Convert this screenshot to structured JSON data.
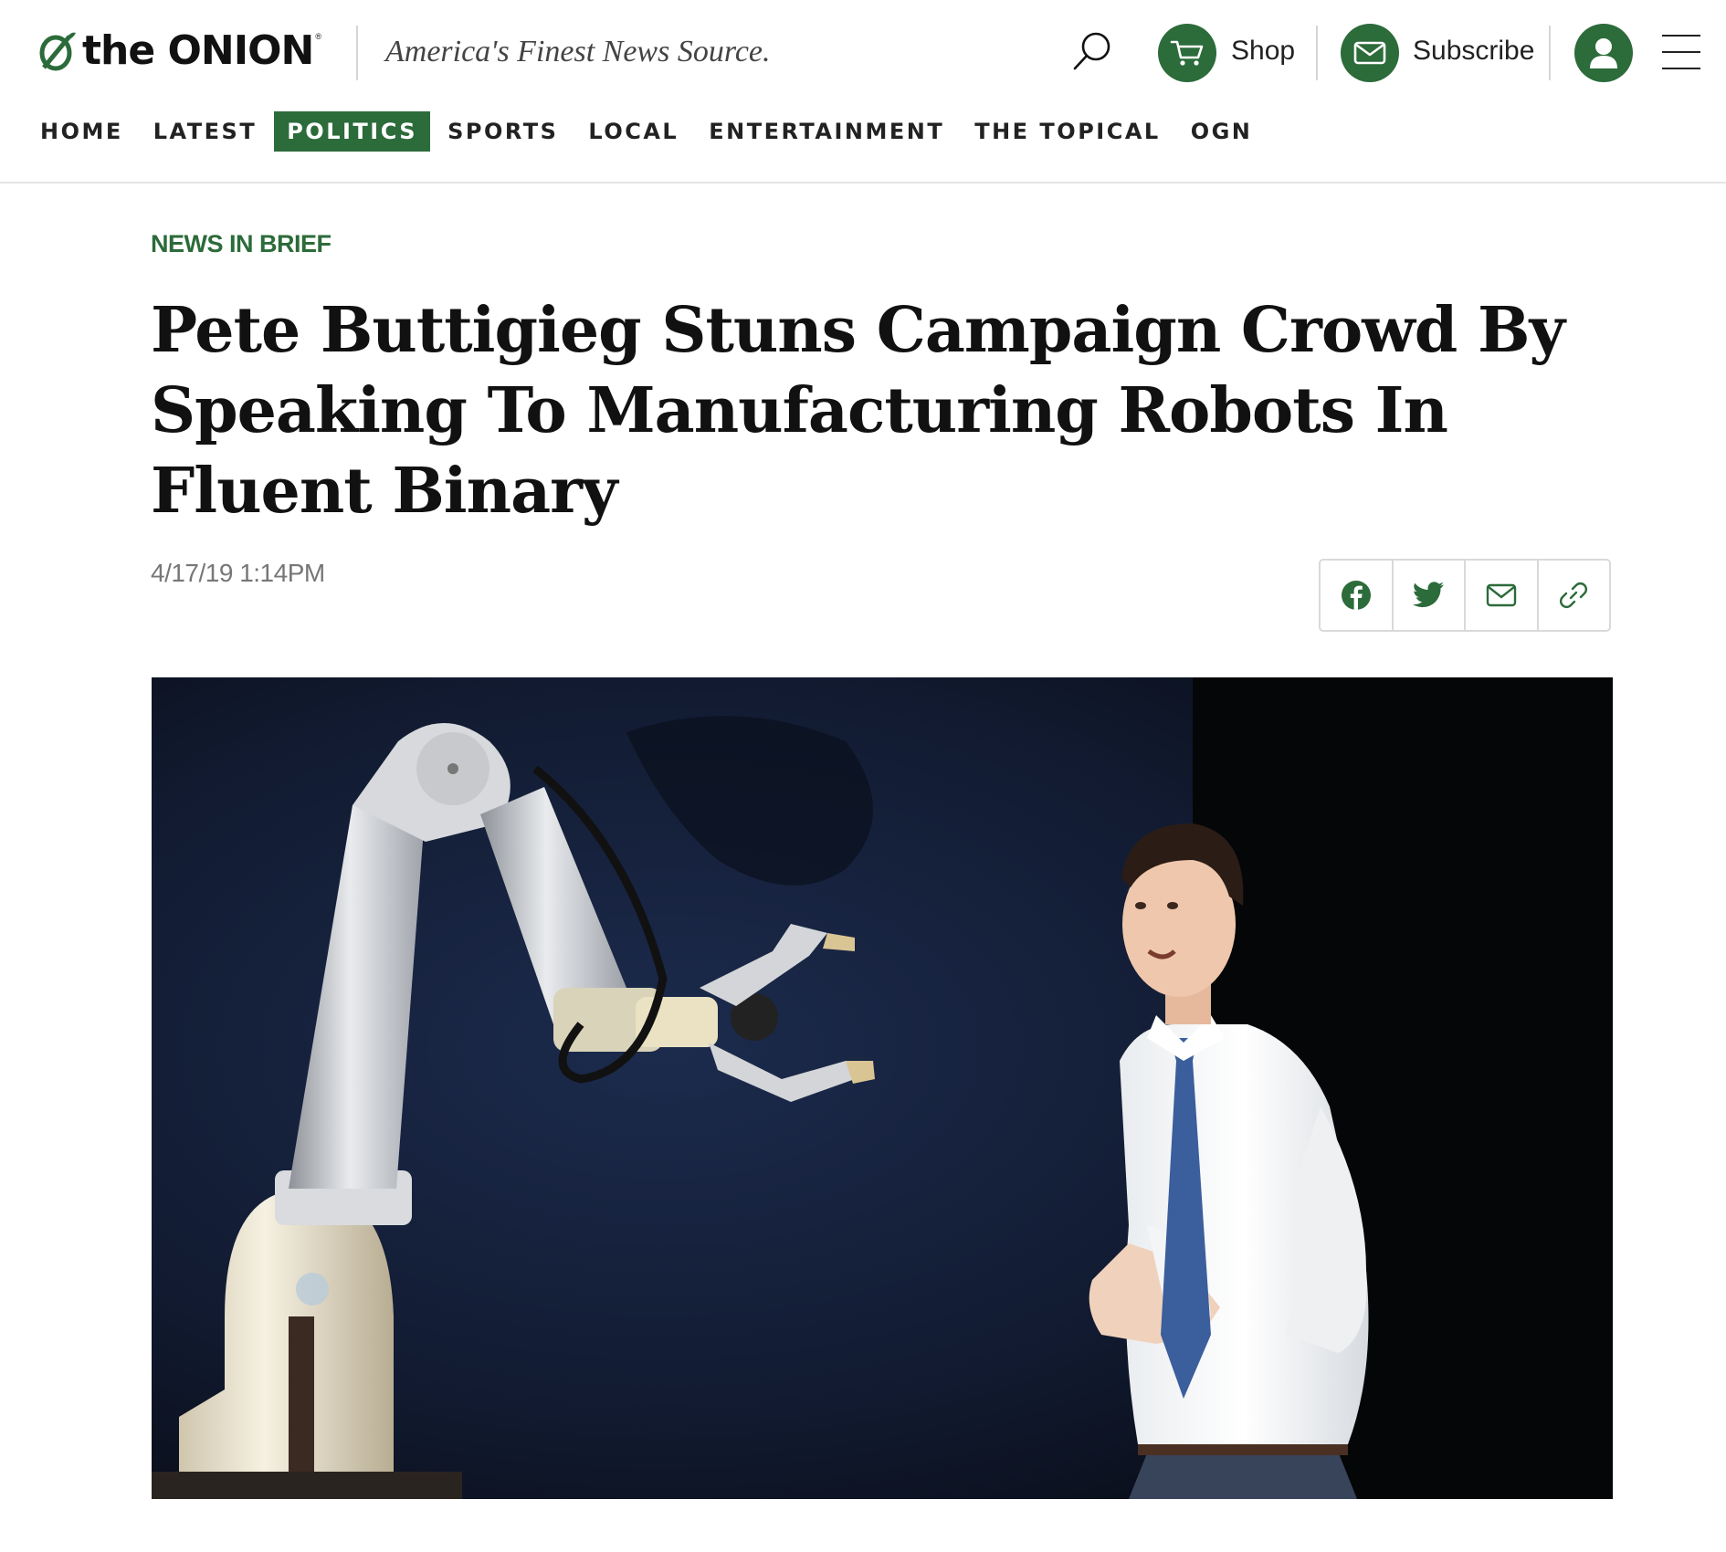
{
  "brand": {
    "logo_text": "the ONION",
    "logo_registered": "®",
    "tagline": "America's Finest News Source.",
    "accent_color": "#2c6b3a"
  },
  "header": {
    "search_icon": "search-icon",
    "shop_label": "Shop",
    "shop_icon": "cart-icon",
    "subscribe_label": "Subscribe",
    "subscribe_icon": "mail-icon",
    "account_icon": "user-icon",
    "menu_icon": "hamburger-icon"
  },
  "nav": {
    "items": [
      {
        "label": "HOME",
        "active": false
      },
      {
        "label": "LATEST",
        "active": false
      },
      {
        "label": "POLITICS",
        "active": true
      },
      {
        "label": "SPORTS",
        "active": false
      },
      {
        "label": "LOCAL",
        "active": false
      },
      {
        "label": "ENTERTAINMENT",
        "active": false
      },
      {
        "label": "THE TOPICAL",
        "active": false
      },
      {
        "label": "OGN",
        "active": false
      }
    ]
  },
  "article": {
    "kicker": "NEWS IN BRIEF",
    "headline": "Pete Buttigieg Stuns Campaign Crowd By Speaking To Manufacturing Robots In Fluent Binary",
    "timestamp": "4/17/19 1:14PM",
    "share_buttons": [
      "facebook-icon",
      "twitter-icon",
      "mail-icon",
      "link-icon"
    ]
  }
}
